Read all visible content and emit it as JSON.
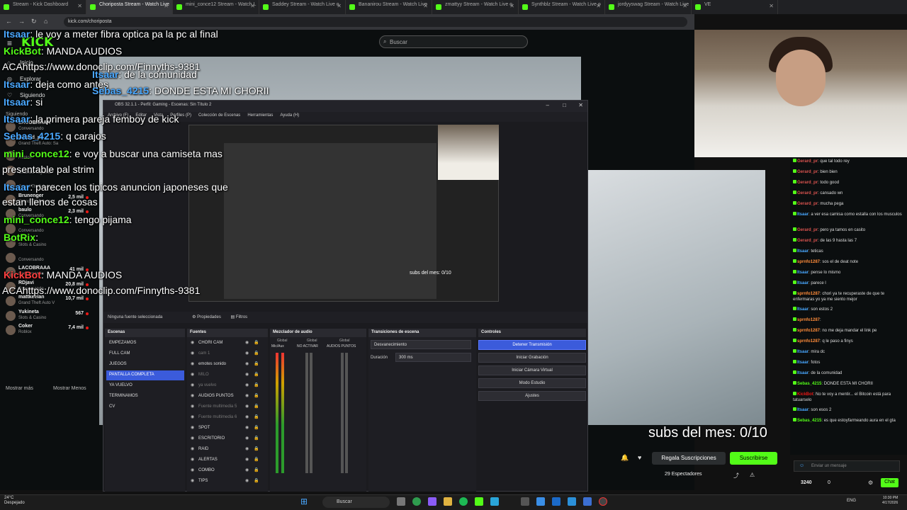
{
  "browser": {
    "tabs": [
      "Stream - Kick Dashboard",
      "Choriposta Stream - Watch Live",
      "mini_conce12 Stream - Watch L",
      "Saddey Stream - Watch Live o",
      "Bananirou Stream - Watch Live",
      "zmattyy Stream - Watch Live o",
      "Synthblz Stream - Watch Live o",
      "jordyyswag Stream - Watch Live",
      "VE"
    ],
    "url": "kick.com/choriposta"
  },
  "kick": {
    "logo": "KICK",
    "search_placeholder": "Buscar",
    "nav": [
      "Inicio",
      "Explorar",
      "Siguiendo"
    ],
    "following_title": "Siguiendo",
    "following": [
      {
        "name": "LACOBRAAA",
        "game": "Conversando",
        "viewers": ""
      },
      {
        "name": "Gerard_pr",
        "game": "Grand Theft Auto: Sa",
        "viewers": ""
      },
      {
        "name": "",
        "game": "Roblox",
        "viewers": ""
      },
      {
        "name": "",
        "game": "Chained Together",
        "viewers": ""
      },
      {
        "name": "",
        "game": "Grand Theft Auto V",
        "viewers": ""
      },
      {
        "name": "Brunenger",
        "game": "Grand Theft Auto V",
        "viewers": "2,5 mil"
      },
      {
        "name": "baulo",
        "game": "Conversando",
        "viewers": "2,3 mil"
      },
      {
        "name": "",
        "game": "Conversando",
        "viewers": ""
      },
      {
        "name": "",
        "game": "Slots & Casino",
        "viewers": ""
      },
      {
        "name": "",
        "game": "Conversando",
        "viewers": ""
      },
      {
        "name": "LACOBRAAA",
        "game": "Conversando",
        "viewers": "41 mil"
      },
      {
        "name": "RDjavi",
        "game": "Conversando",
        "viewers": "20,8 mil"
      },
      {
        "name": "mattkeelan",
        "game": "Grand Theft Auto V",
        "viewers": "10,7 mil"
      },
      {
        "name": "Yukineta",
        "game": "Slots & Casino",
        "viewers": "567"
      },
      {
        "name": "Coker",
        "game": "Roblox",
        "viewers": "7,4 mil"
      }
    ],
    "show_more": "Mostrar más",
    "show_less": "Mostrar Menos",
    "big_subs": "subs del mes: 0/10",
    "gift_button": "Regala Suscripciones",
    "subscribe_button": "Suscribirse",
    "viewers": "29 Espectadores",
    "chat_placeholder": "Enviar un mensaje",
    "chat_button": "Chat",
    "points": "3240",
    "zero": "0"
  },
  "overlay_chat": [
    {
      "user": "Itsaar",
      "text": ": le voy a meter fibra optica pa la pc al final",
      "color": "blue"
    },
    {
      "user": "KickBot",
      "text": ": MANDA AUDIOS",
      "color": "green"
    },
    {
      "user": "",
      "text": "ACAhttps://www.donoclip.com/Finnyths-9381",
      "color": "blue"
    },
    {
      "user": "Itsaar",
      "text": ": de la comunidad",
      "color": "blue"
    },
    {
      "user": "Itsaar",
      "text": ": deja como antes",
      "color": "blue"
    },
    {
      "user": "Sebas_4215",
      "text": ": DONDE ESTA MI CHORII",
      "color": "blue"
    },
    {
      "user": "Itsaar",
      "text": ": si",
      "color": "blue"
    },
    {
      "user": "Itsaar",
      "text": ": la primera pareja femboy de kick",
      "color": "blue"
    },
    {
      "user": "Sebas_4215",
      "text": ": q carajos",
      "color": "blue"
    },
    {
      "user": "mini_conce12",
      "text": ": e voy a buscar una camiseta mas",
      "color": "green"
    },
    {
      "user": "",
      "text": "presentable pal strim",
      "color": "blue"
    },
    {
      "user": "Itsaar",
      "text": ": parecen los tipicos anuncion japoneses que",
      "color": "blue"
    },
    {
      "user": "",
      "text": "estan llenos de cosas",
      "color": "blue"
    },
    {
      "user": "mini_conce12",
      "text": ": tengo pijama",
      "color": "green"
    },
    {
      "user": "BotRix",
      "text": ":",
      "color": "green"
    },
    {
      "user": "KickBot",
      "text": ": MANDA AUDIOS",
      "color": "red"
    },
    {
      "user": "",
      "text": "ACAhttps://www.donoclip.com/Finnyths-9381",
      "color": "blue"
    }
  ],
  "obs": {
    "title": "OBS 32.1.1 - Perfil: Gaming - Escenas: Sin Título 2",
    "menu": [
      "Archivo (F)",
      "Editar",
      "Vista",
      "Perfiles (P)",
      "Colección de Escenas",
      "Herramientas",
      "Ayuda (H)"
    ],
    "preview_subs": "subs del mes: 0/10",
    "source_bar": "Ninguna fuente seleccionada",
    "properties": "Propiedades",
    "filters": "Filtros",
    "docks": {
      "scenes": "Escenas",
      "sources": "Fuentes",
      "mixer": "Mezclador de audio",
      "transitions": "Transiciones de escena",
      "controls": "Controles"
    },
    "scenes": [
      "EMPEZAMOS",
      "FULL CAM",
      "JUEGOS",
      "PANTALLA COMPLETA",
      "YA VUELVO",
      "TERMINAMOS",
      "CV"
    ],
    "selected_scene": 3,
    "sources": [
      {
        "name": "CHORI CAM",
        "dim": false
      },
      {
        "name": "cam 1",
        "dim": true
      },
      {
        "name": "emotes sonido",
        "dim": false
      },
      {
        "name": "MILO",
        "dim": true
      },
      {
        "name": "ya vuelvo",
        "dim": true
      },
      {
        "name": "AUDIOS PUNTOS",
        "dim": false
      },
      {
        "name": "Fuente multimedia 5",
        "dim": true
      },
      {
        "name": "Fuente multimedia 6",
        "dim": true
      },
      {
        "name": "SPOT",
        "dim": false
      },
      {
        "name": "ESCRITORIO",
        "dim": false
      },
      {
        "name": "RAID",
        "dim": false
      },
      {
        "name": "ALERTAS",
        "dim": false
      },
      {
        "name": "COMBO",
        "dim": false
      },
      {
        "name": "TIPS",
        "dim": false
      }
    ],
    "mixer_channels": [
      "Global",
      "Global",
      "Global"
    ],
    "mixer_sub": [
      "Mic/Aux",
      "NO ACTIVAR",
      "AUDIOS PUNTOS"
    ],
    "transition": "Desvanecimiento",
    "duration_label": "Duración",
    "duration": "300 ms",
    "controls": [
      "Detener Transmisión",
      "Iniciar Grabación",
      "Iniciar Cámara Virtual",
      "Modo Estudio",
      "Ajustes"
    ]
  },
  "right_chat": [
    {
      "user": "Gerard_pr",
      "text": ": que tal todo rey",
      "color": "#d9534f"
    },
    {
      "user": "Gerard_pr",
      "text": ": bien bien",
      "color": "#d9534f"
    },
    {
      "user": "Gerard_pr",
      "text": ": todo good",
      "color": "#d9534f"
    },
    {
      "user": "Gerard_pr",
      "text": ": cansado wn",
      "color": "#d9534f"
    },
    {
      "user": "Gerard_pr",
      "text": ": mucha pega",
      "color": "#d9534f"
    },
    {
      "user": "Itsaar",
      "text": ": a ver esa camisa como estalla con los musculos",
      "color": "#4aa8ff"
    },
    {
      "user": "Gerard_pr",
      "text": ": pero ya tamos en casito",
      "color": "#d9534f"
    },
    {
      "user": "Gerard_pr",
      "text": ": de las 9 hasta las 7",
      "color": "#d9534f"
    },
    {
      "user": "Itsaar",
      "text": ": teticas",
      "color": "#4aa8ff"
    },
    {
      "user": "sprnfo1287",
      "text": ": sos el de deat note",
      "color": "#ff8c3a"
    },
    {
      "user": "Itsaar",
      "text": ": pense lo mismo",
      "color": "#4aa8ff"
    },
    {
      "user": "Itsaar",
      "text": ": parece l",
      "color": "#4aa8ff"
    },
    {
      "user": "sprnfo1287",
      "text": ": chori ya te recuperaste de que te enfermaras yo ya me siento mejor",
      "color": "#ff8c3a"
    },
    {
      "user": "Itsaar",
      "text": ": son estos 2",
      "color": "#4aa8ff"
    },
    {
      "user": "sprnfo1287",
      "text": ":",
      "color": "#ff8c3a"
    },
    {
      "user": "sprnfo1287",
      "text": ": no me deja mandar el link pe",
      "color": "#ff8c3a"
    },
    {
      "user": "sprnfo1287",
      "text": ": q le paso a finys",
      "color": "#ff8c3a"
    },
    {
      "user": "Itsaar",
      "text": ": mira dc",
      "color": "#4aa8ff"
    },
    {
      "user": "Itsaar",
      "text": ": fotos",
      "color": "#4aa8ff"
    },
    {
      "user": "Itsaar",
      "text": ": de la comunidad",
      "color": "#4aa8ff"
    },
    {
      "user": "Sebas_4215",
      "text": ": DONDE ESTA MI CHORII",
      "color": "#53fc18"
    },
    {
      "user": "KickBot",
      "text": ": No te voy a mentir... el Bitcoin está para tatuarselo",
      "color": "#e91916"
    },
    {
      "user": "Itsaar",
      "text": ": son esos 2",
      "color": "#4aa8ff"
    },
    {
      "user": "Sebas_4215",
      "text": ": es que estoyfarmeando aura en el gta",
      "color": "#53fc18"
    }
  ],
  "taskbar": {
    "temp": "24°C",
    "weather": "Despejado",
    "search": "Buscar",
    "lang": "ENG",
    "time": "10:30 PM",
    "date": "4/17/2026"
  }
}
